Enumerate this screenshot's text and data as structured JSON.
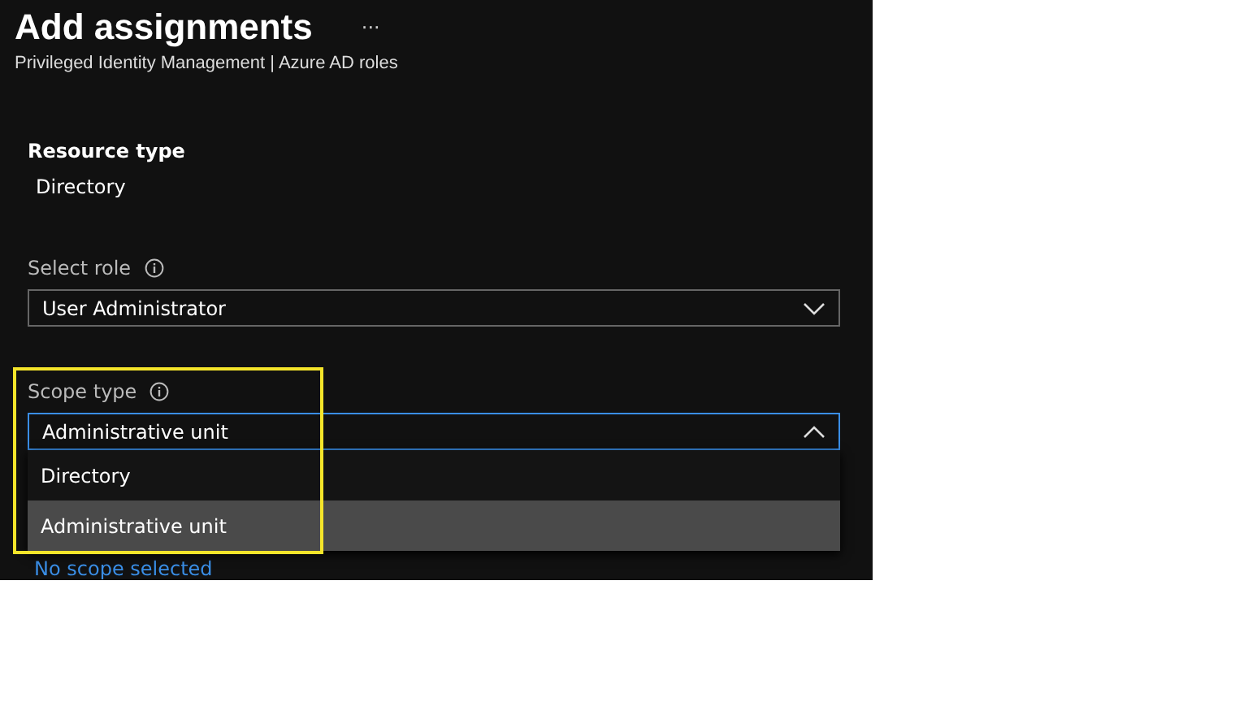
{
  "header": {
    "title": "Add assignments",
    "more": "···",
    "subtitle": "Privileged Identity Management | Azure AD roles"
  },
  "resource": {
    "label": "Resource type",
    "value": "Directory"
  },
  "role": {
    "label": "Select role",
    "value": "User Administrator",
    "expanded": false
  },
  "scope": {
    "label": "Scope type",
    "value": "Administrative unit",
    "expanded": true,
    "options": [
      {
        "label": "Directory",
        "selected": false
      },
      {
        "label": "Administrative unit",
        "selected": true
      }
    ]
  },
  "scope_link": "No scope selected"
}
